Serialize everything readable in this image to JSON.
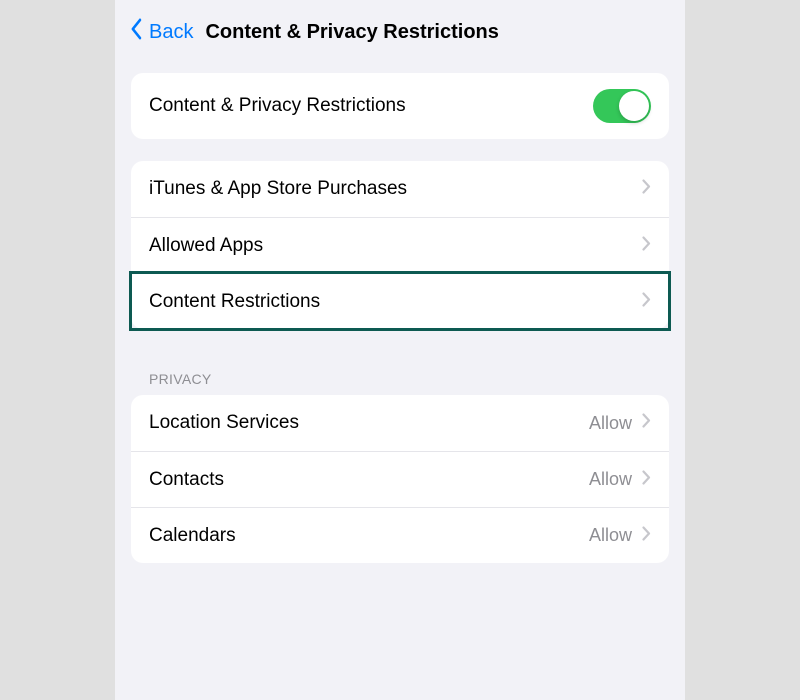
{
  "nav": {
    "back_label": "Back",
    "title": "Content & Privacy Restrictions"
  },
  "toggle_section": {
    "label": "Content & Privacy Restrictions",
    "enabled": true
  },
  "main_group": {
    "items": [
      {
        "label": "iTunes & App Store Purchases"
      },
      {
        "label": "Allowed Apps"
      },
      {
        "label": "Content Restrictions",
        "highlighted": true
      }
    ]
  },
  "privacy_group": {
    "header": "Privacy",
    "items": [
      {
        "label": "Location Services",
        "value": "Allow"
      },
      {
        "label": "Contacts",
        "value": "Allow"
      },
      {
        "label": "Calendars",
        "value": "Allow"
      }
    ]
  },
  "colors": {
    "accent": "#007aff",
    "toggle_on": "#34c759",
    "highlight_border": "#0d5a52"
  }
}
